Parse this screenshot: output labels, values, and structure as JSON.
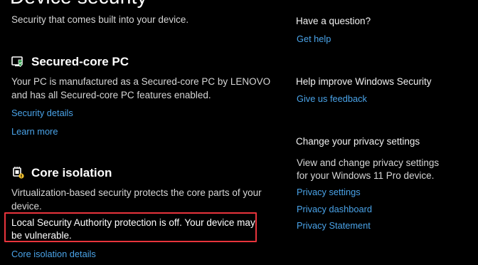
{
  "page": {
    "title": "Device security",
    "subtitle": "Security that comes built into your device."
  },
  "secured_core": {
    "heading": "Secured-core PC",
    "line1": "Your PC is manufactured as a Secured-core PC by LENOVO",
    "line2": "and has all Secured-core PC features enabled.",
    "security_details_link": "Security details",
    "learn_more_link": "Learn more",
    "icon": "chip-shield-icon"
  },
  "core_isolation": {
    "heading": "Core isolation",
    "line1": "Virtualization-based security protects the core parts of your",
    "line2": "device.",
    "warning_line1": "Local Security Authority protection is off. Your device may",
    "warning_line2": "be vulnerable.",
    "details_link": "Core isolation details",
    "icon": "core-isolation-icon"
  },
  "sidebar": {
    "question_heading": "Have a question?",
    "get_help_link": "Get help",
    "improve_heading": "Help improve Windows Security",
    "feedback_link": "Give us feedback",
    "privacy_heading": "Change your privacy settings",
    "privacy_line1": "View and change privacy settings",
    "privacy_line2": "for your Windows 11 Pro device.",
    "privacy_settings_link": "Privacy settings",
    "privacy_dashboard_link": "Privacy dashboard",
    "privacy_statement_link": "Privacy Statement"
  },
  "colors": {
    "background": "#000000",
    "link": "#4aa3e8",
    "warning_outline": "#e8343c"
  }
}
